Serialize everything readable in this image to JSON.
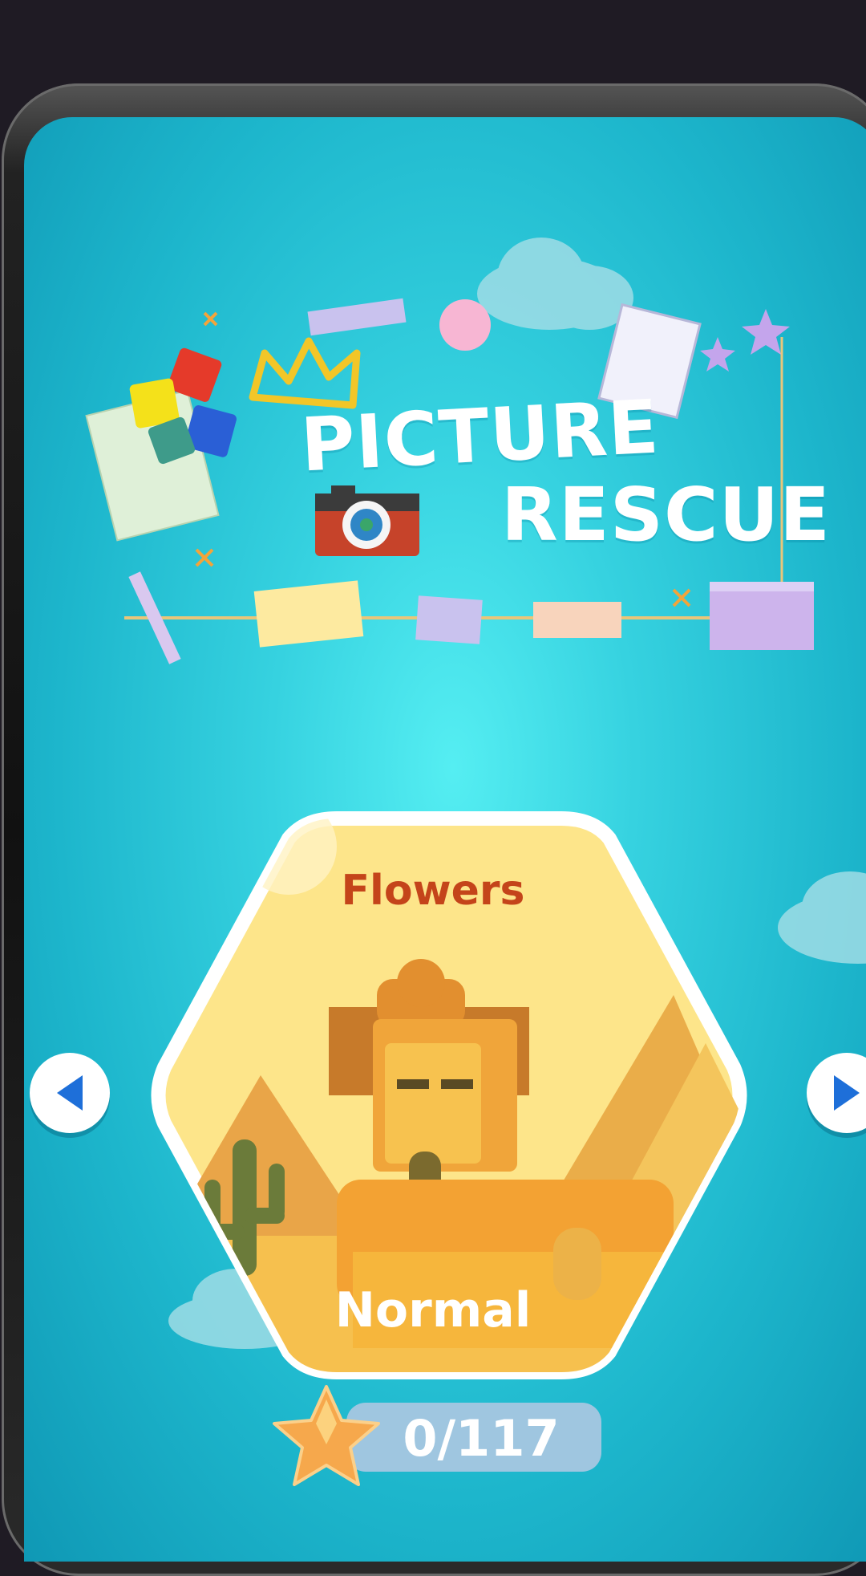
{
  "title": {
    "line1": "PICTURE",
    "line2": "RESCUE"
  },
  "level_card": {
    "category": "Flowers",
    "difficulty": "Normal"
  },
  "progress": {
    "text": "0/117",
    "completed": 0,
    "total": 117
  },
  "icons": {
    "prev": "chevron-left-icon",
    "next": "chevron-right-icon",
    "star": "star-icon",
    "camera": "camera-icon"
  },
  "colors": {
    "background": "#1db6cc",
    "card_fill": "#fde58a",
    "category_text": "#c4441a",
    "nav_arrow": "#1e6fd9"
  }
}
